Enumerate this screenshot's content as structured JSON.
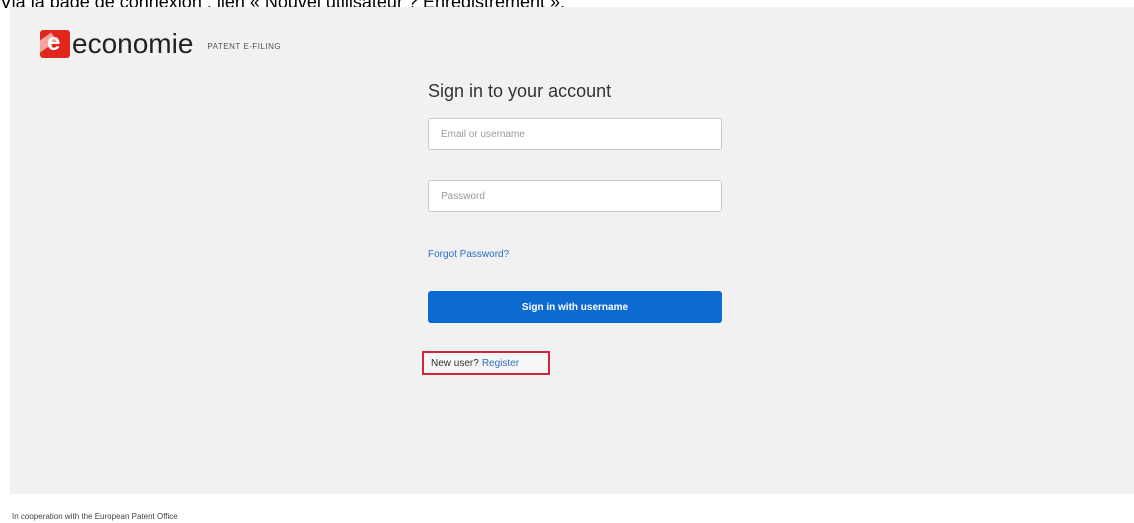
{
  "caption": "Via la page de connexion : lien « Nouvel utilisateur ? Enregistrement ».",
  "header": {
    "logo_text": "economie",
    "logo_subtitle": "PATENT E-FILING"
  },
  "login": {
    "title": "Sign in to your account",
    "email_placeholder": "Email or username",
    "password_placeholder": "Password",
    "forgot_password_label": "Forgot Password?",
    "signin_button_label": "Sign in with username",
    "new_user_label": "New user?",
    "register_label": "Register"
  },
  "footer": {
    "text": "In cooperation with the European Patent Office"
  },
  "colors": {
    "brand_red": "#e0271f",
    "primary_blue": "#0d6ad1",
    "link_blue": "#2a6fc7",
    "highlight_red": "#d0253a"
  }
}
